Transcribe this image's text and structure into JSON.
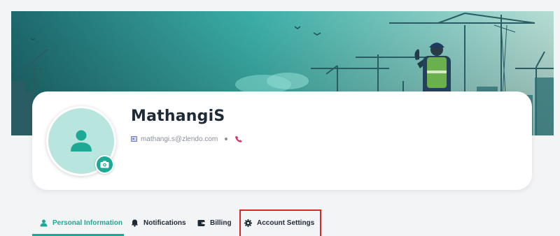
{
  "profile": {
    "name": "MathangiS",
    "email": "mathangi.s@zlendo.com"
  },
  "tabs": [
    {
      "label": "Personal Information",
      "icon": "user-icon",
      "active": true
    },
    {
      "label": "Notifications",
      "icon": "bell-icon",
      "active": false
    },
    {
      "label": "Billing",
      "icon": "wallet-icon",
      "active": false
    },
    {
      "label": "Account Settings",
      "icon": "gear-icon",
      "active": false
    }
  ],
  "colors": {
    "accent": "#1ea896",
    "avatar_bg": "#b8e6de",
    "highlight": "#d62828",
    "text_dark": "#1f2a37",
    "phone_icon": "#d6336c"
  }
}
